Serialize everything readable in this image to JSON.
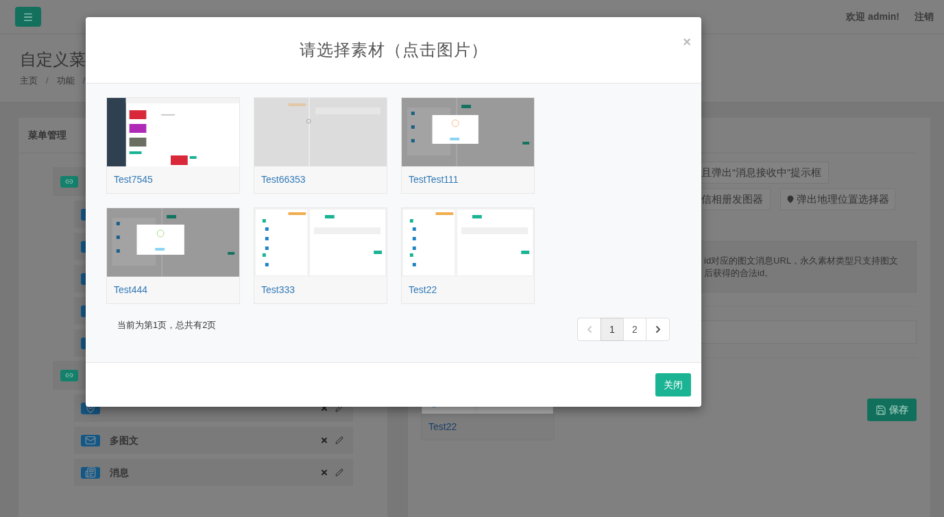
{
  "topbar": {
    "user": "欢迎 admin!",
    "logout": "注销"
  },
  "page": {
    "title": "自定义菜",
    "breadcrumbs": [
      {
        "label": "主页",
        "separator": "/"
      },
      {
        "label": "功能",
        "separator": "/"
      }
    ]
  },
  "menu_panel": {
    "title": "菜单管理",
    "groups": [
      {
        "children": [
          {
            "kind": "item"
          },
          {
            "kind": "item"
          },
          {
            "kind": "item"
          },
          {
            "kind": "item"
          },
          {
            "kind": "item"
          }
        ]
      },
      {
        "children": [
          {
            "kind": "location"
          },
          {
            "kind": "news",
            "label": "多图文"
          },
          {
            "kind": "text",
            "label": "消息"
          }
        ]
      }
    ]
  },
  "editor": {
    "actions": [
      [
        "且弹出“消息接收中”提示框"
      ],
      [
        "信相册发图器",
        "弹出地理位置选择器"
      ]
    ],
    "notice": [
      "id对应的图文消息URL，永久素材类型只支持图文",
      "后获得的合法id。"
    ],
    "save": "保存",
    "selected_material": {
      "title": "Test22",
      "kind": "tree"
    }
  },
  "modal": {
    "title": "请选择素材（点击图片）",
    "close": "×",
    "materials": [
      {
        "title": "Test7545",
        "kind": "sidebar"
      },
      {
        "title": "Test66353",
        "kind": "loading"
      },
      {
        "title": "TestTest111",
        "kind": "alert"
      },
      {
        "title": "Test444",
        "kind": "success"
      },
      {
        "title": "Test333",
        "kind": "tree"
      },
      {
        "title": "Test22",
        "kind": "tree"
      }
    ],
    "pager_text": "当前为第1页，总共有2页",
    "prev": {
      "disabled": true
    },
    "next": {
      "disabled": false
    },
    "pages": [
      {
        "label": "1",
        "selected": true
      },
      {
        "label": "2",
        "selected": false
      }
    ],
    "close_button": "关闭"
  }
}
